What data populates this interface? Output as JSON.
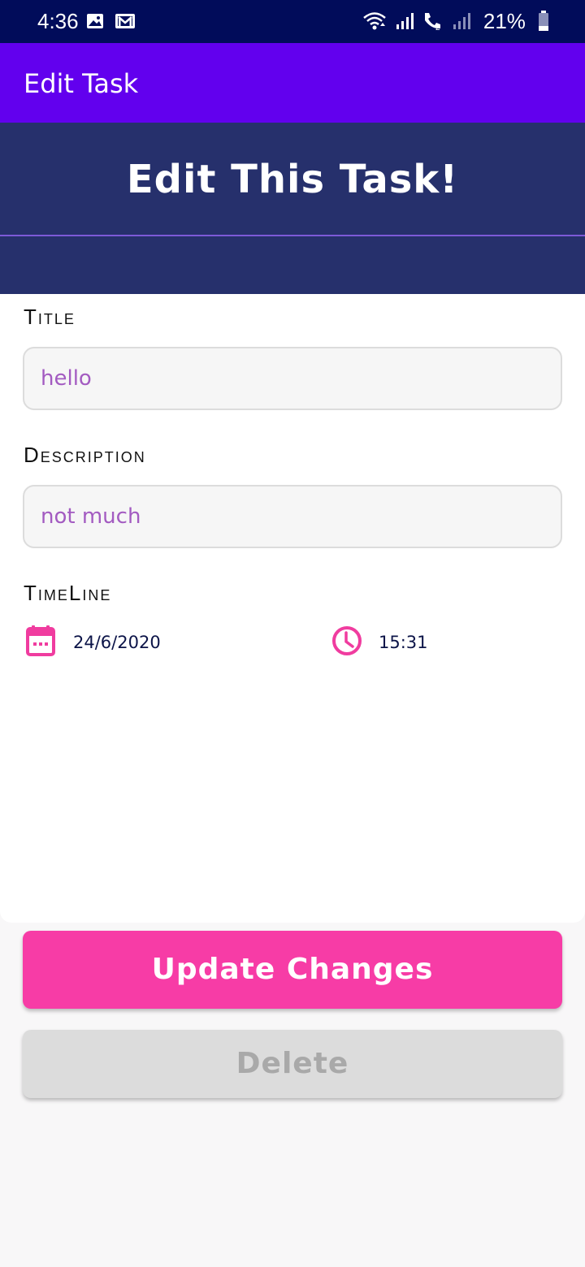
{
  "status_bar": {
    "time": "4:36",
    "battery_percent": "21%",
    "icons": [
      "image-icon",
      "gmail-icon",
      "wifi-icon",
      "signal-icon",
      "wifi-calling-icon",
      "signal-icon",
      "battery-icon"
    ]
  },
  "app_bar": {
    "title": "Edit Task"
  },
  "header": {
    "title": "Edit This Task!"
  },
  "form": {
    "title_label": "Title",
    "title_value": "hello",
    "description_label": "Description",
    "description_value": "not much",
    "timeline_label": "TimeLine",
    "date": "24/6/2020",
    "time": "15:31",
    "date_icon": "calendar-icon",
    "time_icon": "clock-icon"
  },
  "buttons": {
    "update": "Update Changes",
    "delete": "Delete"
  },
  "colors": {
    "status_bar": "#010c5a",
    "app_bar": "#6200ee",
    "header": "#26306c",
    "accent": "#f73ca6",
    "field_text": "#a35bc1"
  }
}
